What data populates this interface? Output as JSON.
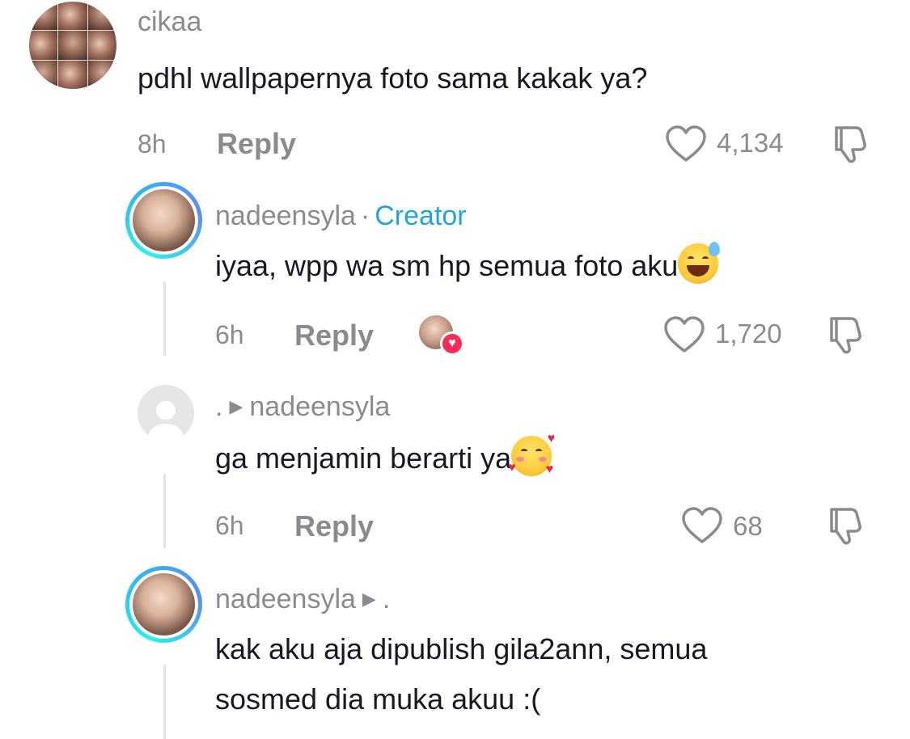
{
  "comments": [
    {
      "username": "cikaa",
      "text": "pdhl wallpapernya foto sama kakak ya?",
      "time": "8h",
      "reply_label": "Reply",
      "likes": "4,134"
    },
    {
      "username": "nadeensyla",
      "separator": "·",
      "badge": "Creator",
      "text": "iyaa, wpp wa sm hp semua foto aku",
      "emoji": "grinning-face-with-sweat",
      "time": "6h",
      "reply_label": "Reply",
      "likes": "1,720"
    },
    {
      "username": ".",
      "reply_to": "nadeensyla",
      "text": "ga menjamin berarti ya",
      "emoji": "smiling-face-with-hearts",
      "time": "6h",
      "reply_label": "Reply",
      "likes": "68"
    },
    {
      "username": "nadeensyla",
      "reply_to": ".",
      "text_line1": "kak aku aja dipublish gila2ann, semua",
      "text_line2": "sosmed dia muka akuu :("
    }
  ],
  "colors": {
    "text": "#161823",
    "muted": "#8a8b91",
    "creator": "#20a5d8",
    "like_heart": "#fe2c55"
  }
}
